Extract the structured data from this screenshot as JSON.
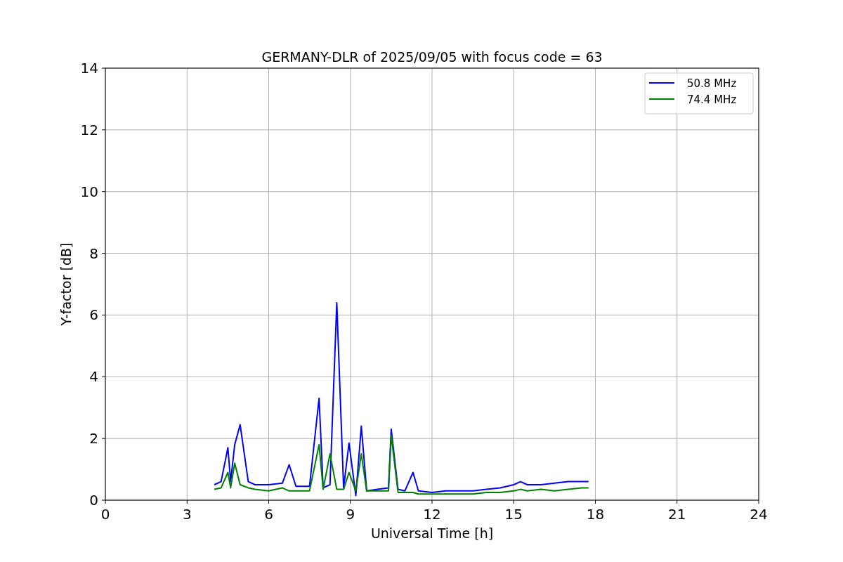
{
  "figure": {
    "chart_data": {
      "type": "line",
      "title": "GERMANY-DLR of 2025/09/05 with focus code = 63",
      "xlabel": "Universal Time [h]",
      "ylabel": "Y-factor [dB]",
      "x": [
        4,
        4.25,
        4.5,
        4.6,
        4.75,
        4.95,
        5.25,
        5.5,
        6,
        6.5,
        6.75,
        7,
        7.5,
        7.85,
        8,
        8.25,
        8.5,
        8.75,
        8.95,
        9.2,
        9.4,
        9.6,
        10,
        10.4,
        10.5,
        10.75,
        11,
        11.3,
        11.5,
        12,
        12.5,
        13,
        13.5,
        14,
        14.5,
        15,
        15.25,
        15.5,
        16,
        16.5,
        17,
        17.5,
        17.75
      ],
      "series": [
        {
          "name": "50.8 MHz",
          "color": "#0000ff",
          "values": [
            0.5,
            0.6,
            1.7,
            0.6,
            1.8,
            2.45,
            0.6,
            0.5,
            0.5,
            0.55,
            1.15,
            0.45,
            0.45,
            3.3,
            0.4,
            0.5,
            6.4,
            0.4,
            1.85,
            0.15,
            2.4,
            0.3,
            0.35,
            0.4,
            2.3,
            0.35,
            0.3,
            0.9,
            0.3,
            0.25,
            0.3,
            0.3,
            0.3,
            0.35,
            0.4,
            0.5,
            0.6,
            0.5,
            0.5,
            0.55,
            0.6,
            0.6,
            0.6
          ]
        },
        {
          "name": "74.4 MHz",
          "color": "#008000",
          "values": [
            0.35,
            0.4,
            0.9,
            0.4,
            1.2,
            0.5,
            0.4,
            0.35,
            0.3,
            0.4,
            0.3,
            0.3,
            0.3,
            1.8,
            0.35,
            1.5,
            0.35,
            0.35,
            0.9,
            0.3,
            1.5,
            0.3,
            0.3,
            0.3,
            2.1,
            0.25,
            0.25,
            0.25,
            0.2,
            0.2,
            0.2,
            0.2,
            0.2,
            0.25,
            0.25,
            0.3,
            0.35,
            0.3,
            0.35,
            0.3,
            0.35,
            0.4,
            0.4
          ]
        }
      ],
      "xlim": [
        0,
        24
      ],
      "ylim": [
        0,
        14
      ],
      "xticks": [
        0,
        3,
        6,
        9,
        12,
        15,
        18,
        21,
        24
      ],
      "yticks": [
        0,
        2,
        4,
        6,
        8,
        10,
        12,
        14
      ],
      "grid": true,
      "legend": true
    }
  }
}
